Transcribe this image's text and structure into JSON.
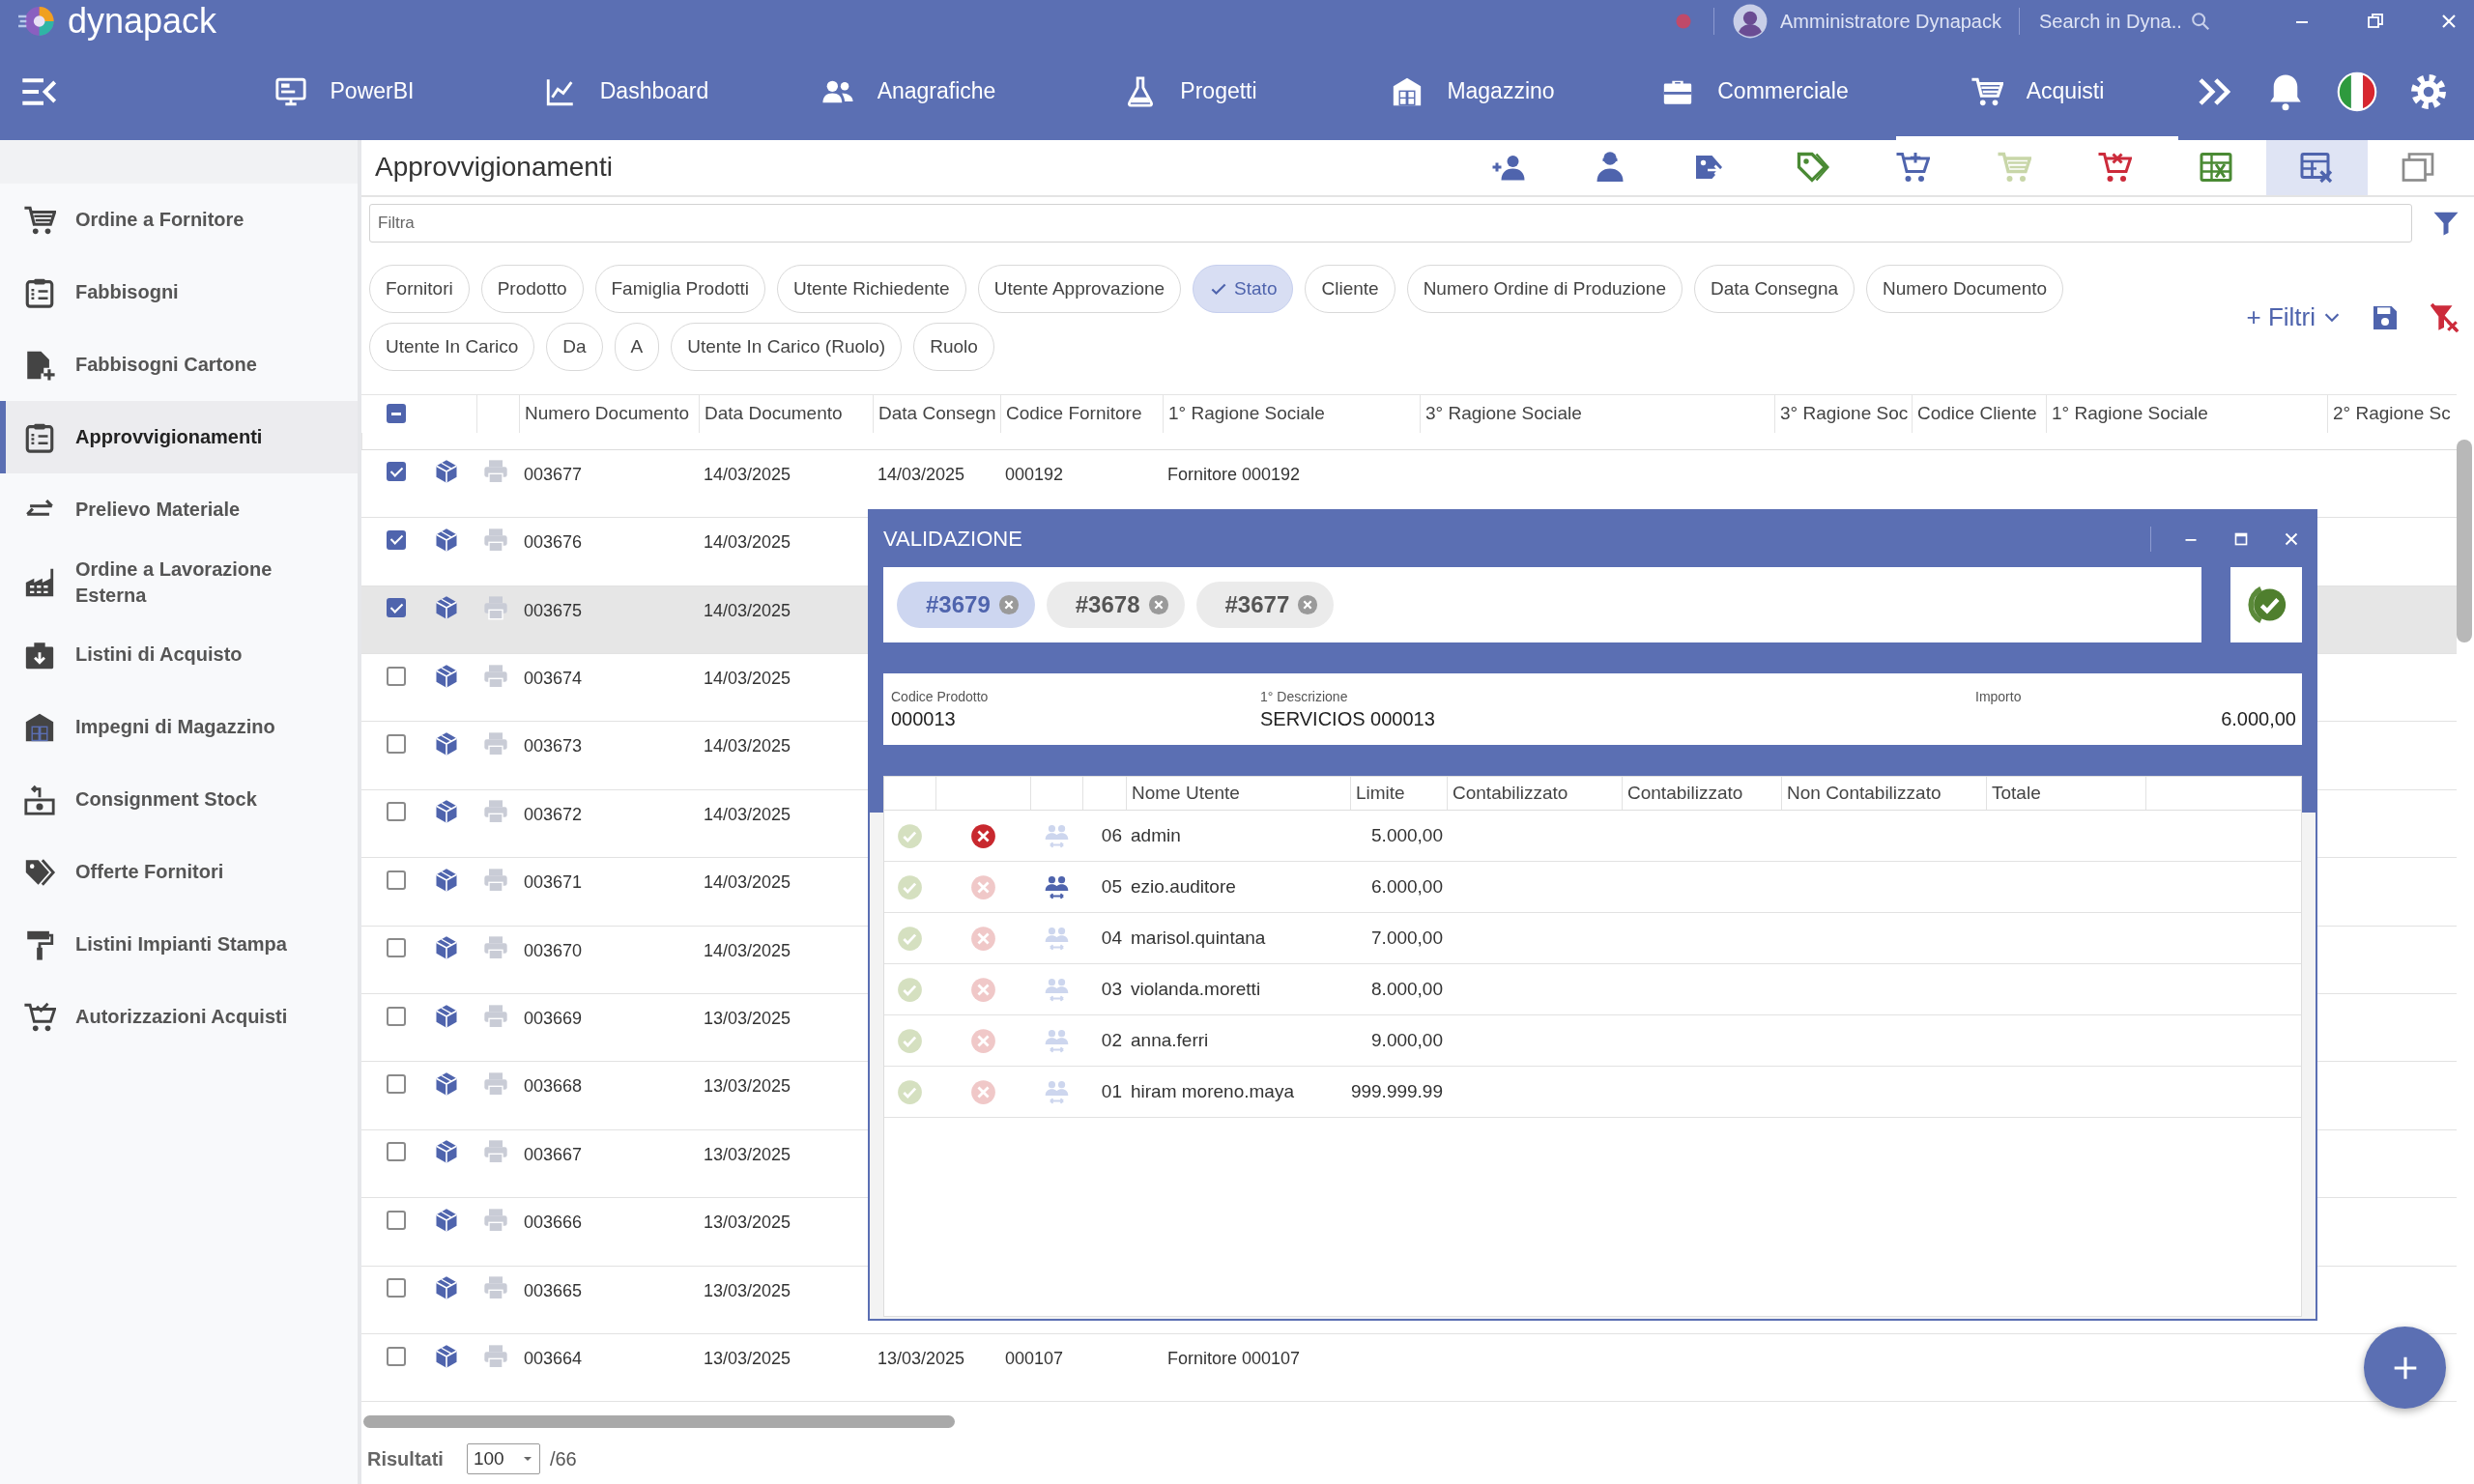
{
  "app": {
    "logo": "dynapack",
    "user": "Amministratore Dynapack",
    "search": {
      "placeholder": "Search in Dyna.."
    }
  },
  "nav": [
    {
      "label": "PowerBI",
      "selected": false
    },
    {
      "label": "Dashboard",
      "selected": false
    },
    {
      "label": "Anagrafiche",
      "selected": false
    },
    {
      "label": "Progetti",
      "selected": false
    },
    {
      "label": "Magazzino",
      "selected": false
    },
    {
      "label": "Commerciale",
      "selected": false
    },
    {
      "label": "Acquisti",
      "selected": true
    }
  ],
  "sidebar": {
    "items": [
      {
        "label": "Ordine a Fornitore",
        "selected": false
      },
      {
        "label": "Fabbisogni",
        "selected": false
      },
      {
        "label": "Fabbisogni Cartone",
        "selected": false
      },
      {
        "label": "Approvvigionamenti",
        "selected": true
      },
      {
        "label": "Prelievo Materiale",
        "selected": false
      },
      {
        "label": "Ordine a Lavorazione Esterna",
        "selected": false
      },
      {
        "label": "Listini di Acquisto",
        "selected": false
      },
      {
        "label": "Impegni di Magazzino",
        "selected": false
      },
      {
        "label": "Consignment Stock",
        "selected": false
      },
      {
        "label": "Offerte Fornitori",
        "selected": false
      },
      {
        "label": "Listini Impianti Stampa",
        "selected": false
      },
      {
        "label": "Autorizzazioni Acquisti",
        "selected": false
      }
    ]
  },
  "page": {
    "title": "Approvvigionamenti",
    "toolbar": [
      {
        "selected": false
      },
      {
        "selected": false
      },
      {
        "selected": false
      },
      {
        "selected": false
      },
      {
        "selected": false
      },
      {
        "selected": false
      },
      {
        "selected": false
      },
      {
        "selected": false
      },
      {
        "selected": true
      },
      {
        "selected": false
      }
    ],
    "filter": {
      "placeholder": "Filtra"
    },
    "chips": [
      {
        "label": "Fornitori",
        "selected": false
      },
      {
        "label": "Prodotto",
        "selected": false
      },
      {
        "label": "Famiglia Prodotti",
        "selected": false
      },
      {
        "label": "Utente Richiedente",
        "selected": false
      },
      {
        "label": "Utente Approvazione",
        "selected": false
      },
      {
        "label": "Stato",
        "selected": true
      },
      {
        "label": "Cliente",
        "selected": false
      },
      {
        "label": "Numero Ordine di Produzione",
        "selected": false
      },
      {
        "label": "Data Consegna",
        "selected": false
      },
      {
        "label": "Numero Documento",
        "selected": false
      },
      {
        "label": "Utente In Carico",
        "selected": false
      },
      {
        "label": "Da",
        "selected": false
      },
      {
        "label": "A",
        "selected": false
      },
      {
        "label": "Utente In Carico (Ruolo)",
        "selected": false
      },
      {
        "label": "Ruolo",
        "selected": false
      }
    ],
    "more_filters": "+ Filtri"
  },
  "table": {
    "select_all_partial": true,
    "columns": [
      "Numero Documento",
      "Data Documento",
      "Data Consegn",
      "Codice Fornitore",
      "1° Ragione Sociale",
      "3° Ragione Sociale",
      "3° Ragione Soc",
      "Codice Cliente",
      "1° Ragione Sociale",
      "2° Ragione Sc"
    ],
    "rows": [
      {
        "checked": true,
        "selected": false,
        "cells": [
          "003677",
          "14/03/2025",
          "14/03/2025",
          "000192",
          "Fornitore 000192"
        ]
      },
      {
        "checked": true,
        "selected": false,
        "cells": [
          "003676",
          "14/03/2025"
        ]
      },
      {
        "checked": true,
        "selected": true,
        "cells": [
          "003675",
          "14/03/2025"
        ]
      },
      {
        "checked": false,
        "selected": false,
        "cells": [
          "003674",
          "14/03/2025"
        ]
      },
      {
        "checked": false,
        "selected": false,
        "cells": [
          "003673",
          "14/03/2025"
        ]
      },
      {
        "checked": false,
        "selected": false,
        "cells": [
          "003672",
          "14/03/2025"
        ]
      },
      {
        "checked": false,
        "selected": false,
        "cells": [
          "003671",
          "14/03/2025"
        ]
      },
      {
        "checked": false,
        "selected": false,
        "cells": [
          "003670",
          "14/03/2025"
        ]
      },
      {
        "checked": false,
        "selected": false,
        "cells": [
          "003669",
          "13/03/2025"
        ]
      },
      {
        "checked": false,
        "selected": false,
        "cells": [
          "003668",
          "13/03/2025"
        ]
      },
      {
        "checked": false,
        "selected": false,
        "cells": [
          "003667",
          "13/03/2025"
        ]
      },
      {
        "checked": false,
        "selected": false,
        "cells": [
          "003666",
          "13/03/2025"
        ]
      },
      {
        "checked": false,
        "selected": false,
        "cells": [
          "003665",
          "13/03/2025"
        ]
      },
      {
        "checked": false,
        "selected": false,
        "cells": [
          "003664",
          "13/03/2025",
          "13/03/2025",
          "000107",
          "Fornitore 000107"
        ]
      }
    ]
  },
  "footer": {
    "label": "Risultati",
    "page_size": "100",
    "total": "/66"
  },
  "dialog": {
    "title": "VALIDAZIONE",
    "tags": [
      {
        "label": "#3679",
        "selected": true
      },
      {
        "label": "#3678",
        "selected": false
      },
      {
        "label": "#3677",
        "selected": false
      }
    ],
    "info": [
      {
        "label": "Codice Prodotto",
        "value": "000013"
      },
      {
        "label": "1° Descrizione",
        "value": "SERVICIOS 000013"
      },
      {
        "label": "Importo",
        "value": "6.000,00"
      }
    ],
    "columns": [
      "Nome Utente",
      "Limite",
      "Contabilizzato",
      "Contabilizzato",
      "Non Contabilizzato",
      "Totale"
    ],
    "rows": [
      {
        "approved": false,
        "rejected": true,
        "delegated": false,
        "level_no": "06",
        "user": "admin",
        "limit": "5.000,00"
      },
      {
        "approved": false,
        "rejected": false,
        "delegated": true,
        "level_no": "05",
        "user": "ezio.auditore",
        "limit": "6.000,00"
      },
      {
        "approved": false,
        "rejected": false,
        "delegated": false,
        "level_no": "04",
        "user": "marisol.quintana",
        "limit": "7.000,00"
      },
      {
        "approved": false,
        "rejected": false,
        "delegated": false,
        "level_no": "03",
        "user": "violanda.moretti",
        "limit": "8.000,00"
      },
      {
        "approved": false,
        "rejected": false,
        "delegated": false,
        "level_no": "02",
        "user": "anna.ferri",
        "limit": "9.000,00"
      },
      {
        "approved": false,
        "rejected": false,
        "delegated": false,
        "level_no": "01",
        "user": "hiram moreno.maya",
        "limit": "999.999.99"
      }
    ]
  }
}
